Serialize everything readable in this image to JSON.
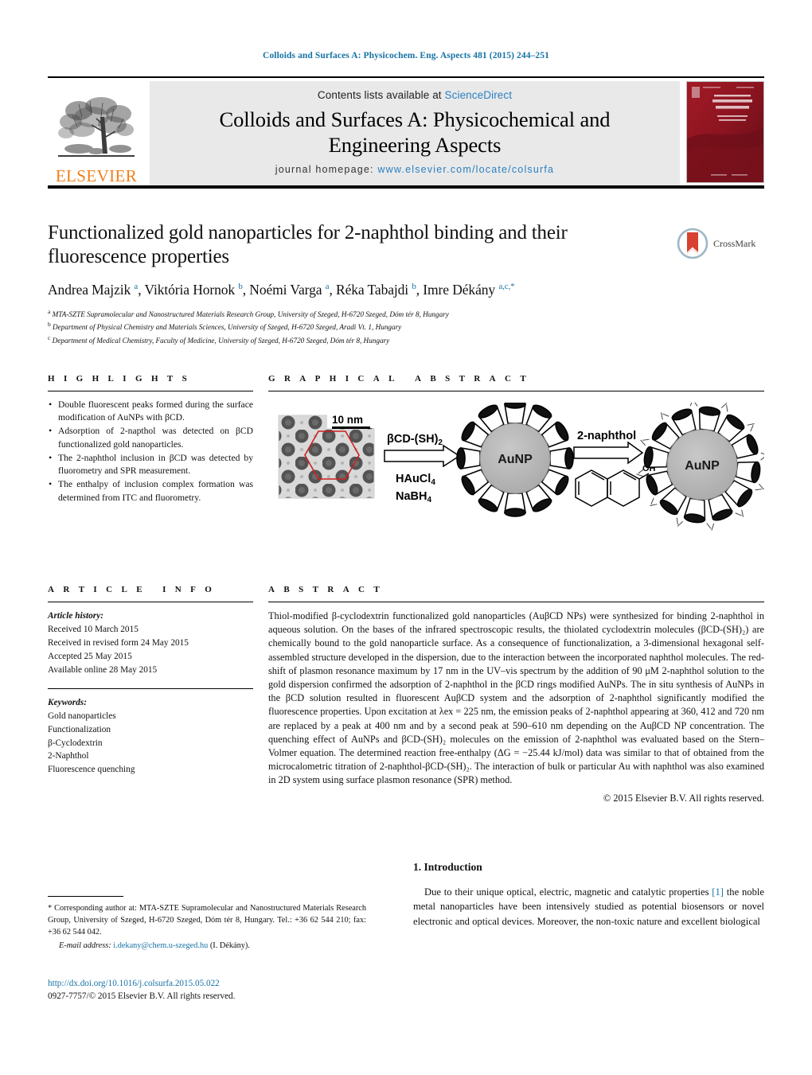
{
  "running_head": "Colloids and Surfaces A: Physicochem. Eng. Aspects 481 (2015) 244–251",
  "masthead": {
    "contents_prefix": "Contents lists available at",
    "sciencedirect": "ScienceDirect",
    "journal_title_line1": "Colloids and Surfaces A: Physicochemical and",
    "journal_title_line2": "Engineering Aspects",
    "homepage_label": "journal homepage:",
    "homepage_url": "www.elsevier.com/locate/colsurfa",
    "publisher": "ELSEVIER",
    "cover_title_line1": "COLLOIDS AND",
    "cover_title_line2": "SURFACES A",
    "cover_sub": "Physicochemical and Engineering Aspects"
  },
  "article": {
    "title": "Functionalized gold nanoparticles for 2-naphthol binding and their fluorescence properties",
    "authors_html": "Andrea Majzik <sup>a</sup>, Viktória Hornok <sup>b</sup>, Noémi Varga <sup>a</sup>, Réka Tabajdi <sup>b</sup>, Imre Dékány <sup>a,c,*</sup>",
    "affiliations": [
      {
        "marker": "a",
        "text": "MTA-SZTE Supramolecular and Nanostructured Materials Research Group, University of Szeged, H-6720 Szeged, Dóm tér 8, Hungary"
      },
      {
        "marker": "b",
        "text": "Department of Physical Chemistry and Materials Sciences, University of Szeged, H-6720 Szeged, Aradi Vt. 1, Hungary"
      },
      {
        "marker": "c",
        "text": "Department of Medical Chemistry, Faculty of Medicine, University of Szeged, H-6720 Szeged, Dóm tér 8, Hungary"
      }
    ],
    "crossmark_label": "CrossMark"
  },
  "highlights": {
    "heading": "HIGHLIGHTS",
    "items": [
      "Double fluorescent peaks formed during the surface modification of AuNPs with βCD.",
      "Adsorption of 2-napthol was detected on βCD functionalized gold nanoparticles.",
      "The 2-naphthol inclusion in βCD was detected by fluorometry and SPR measurement.",
      "The enthalpy of inclusion complex formation was determined from ITC and fluorometry."
    ]
  },
  "graphical_abstract": {
    "heading": "GRAPHICAL ABSTRACT",
    "tem_scalebar": "10 nm",
    "arrow1_above": "βCD-(SH)₂",
    "arrow1_below_line1": "HAuCl₄",
    "arrow1_below_line2": "NaBH₄",
    "particle1_label": "AuNP",
    "arrow2_above": "2-naphthol",
    "naphthol_oh": "OH",
    "particle2_label": "AuNP"
  },
  "article_info": {
    "heading": "ARTICLE INFO",
    "history_label": "Article history:",
    "history": [
      "Received 10 March 2015",
      "Received in revised form 24 May 2015",
      "Accepted 25 May 2015",
      "Available online 28 May 2015"
    ],
    "keywords_label": "Keywords:",
    "keywords": [
      "Gold nanoparticles",
      "Functionalization",
      "β-Cyclodextrin",
      "2-Naphthol",
      "Fluorescence quenching"
    ]
  },
  "abstract": {
    "heading": "ABSTRACT",
    "body": "Thiol-modified β-cyclodextrin functionalized gold nanoparticles (AuβCD NPs) were synthesized for binding 2-naphthol in aqueous solution. On the bases of the infrared spectroscopic results, the thiolated cyclodextrin molecules (βCD-(SH)₂) are chemically bound to the gold nanoparticle surface. As a consequence of functionalization, a 3-dimensional hexagonal self-assembled structure developed in the dispersion, due to the interaction between the incorporated naphthol molecules. The red-shift of plasmon resonance maximum by 17 nm in the UV–vis spectrum by the addition of 90 μM 2-naphthol solution to the gold dispersion confirmed the adsorption of 2-naphthol in the βCD rings modified AuNPs. The in situ synthesis of AuNPs in the βCD solution resulted in fluorescent AuβCD system and the adsorption of 2-naphthol significantly modified the fluorescence properties. Upon excitation at λex = 225 nm, the emission peaks of 2-naphthol appearing at 360, 412 and 720 nm are replaced by a peak at 400 nm and by a second peak at 590–610 nm depending on the AuβCD NP concentration. The quenching effect of AuNPs and βCD-(SH)₂ molecules on the emission of 2-naphthol was evaluated based on the Stern–Volmer equation. The determined reaction free-enthalpy (ΔG = −25.44 kJ/mol) data was similar to that of obtained from the microcalometric titration of 2-naphthol-βCD-(SH)₂. The interaction of bulk or particular Au with naphthol was also examined in 2D system using surface plasmon resonance (SPR) method.",
    "copyright": "© 2015 Elsevier B.V. All rights reserved."
  },
  "introduction": {
    "heading": "1. Introduction",
    "paragraph_pre": "Due to their unique optical, electric, magnetic and catalytic properties ",
    "reference": "[1]",
    "paragraph_post": " the noble metal nanoparticles have been intensively studied as potential biosensors or novel electronic and optical devices. Moreover, the non-toxic nature and excellent biological"
  },
  "footnote": {
    "corresponding": "* Corresponding author at: MTA-SZTE Supramolecular and Nanostructured Materials Research Group, University of Szeged, H-6720 Szeged, Dóm tér 8, Hungary. Tel.: +36 62 544 210; fax: +36 62 544 042.",
    "email_label": "E-mail address:",
    "email": "i.dekany@chem.u-szeged.hu",
    "email_owner": "(I. Dékány).",
    "doi": "http://dx.doi.org/10.1016/j.colsurfa.2015.05.022",
    "issn": "0927-7757/© 2015 Elsevier B.V. All rights reserved."
  },
  "colors": {
    "link_blue": "#1673a5",
    "sd_blue": "#2a7fc1",
    "elsevier_orange": "#ef7f1a",
    "cover_red": "#8c1420",
    "band_gray": "#e9e9e9",
    "particle_gray": "#b0b0b0",
    "hexagon_red": "#cc1f1f"
  }
}
